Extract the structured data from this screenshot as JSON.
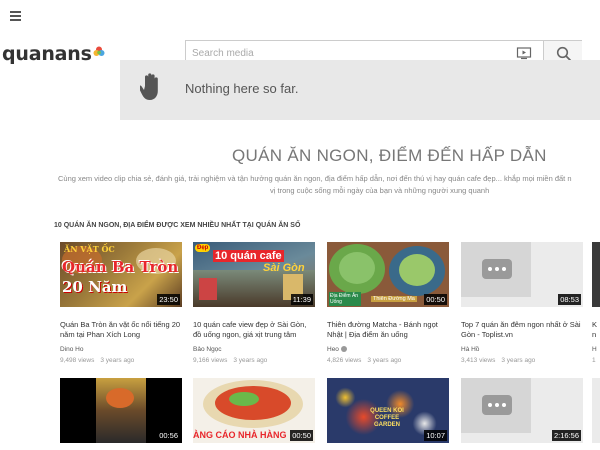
{
  "header": {
    "logo_text": "quanans",
    "search_placeholder": "Search media"
  },
  "empty_state": {
    "message": "Nothing here so far."
  },
  "hero": {
    "title": "QUÁN ĂN NGON, ĐIỂM ĐẾN HẤP DẪN",
    "subtitle_line1": "Cùng xem video clip chia sẻ, đánh giá, trải nghiệm và tận hưởng quán ăn ngon, địa điểm hấp dẫn, nơi đến thú vị hay quán cafe đẹp... khắp mọi miền đất n",
    "subtitle_line2": "vị trong cuộc sống mỗi ngày của bạn và những người xung quanh"
  },
  "section": {
    "title": "10 QUÁN ĂN NGON, ĐỊA ĐIỂM ĐƯỢC XEM NHIỀU NHẤT TẠI QUÁN ĂN SỐ"
  },
  "videos_row1": [
    {
      "title": "Quán Ba Tròn ăn vặt ốc nổi tiếng 20 năm tại Phan Xích Long",
      "channel": "Dino Ho",
      "views": "9,498 views",
      "age": "3 years ago",
      "duration": "23:50",
      "thumb_text_top": "ĂN VẶT ỐC",
      "thumb_text_main": "Quán Ba Tròn",
      "thumb_text_sub": "20 Năm"
    },
    {
      "title": "10 quán cafe view đẹp ở Sài Gòn, đồ uống ngon, giá xịt trung tâm",
      "channel": "Bảo Ngọc",
      "views": "9,166 views",
      "age": "3 years ago",
      "duration": "11:39",
      "thumb_text_main": "10 quán cafe",
      "thumb_text_sub": "Sài Gòn",
      "thumb_badge": "Đẹp"
    },
    {
      "title": "Thiên đường Matcha - Bánh ngọt Nhật | Địa điểm ăn uống",
      "channel": "Heo",
      "views": "4,826 views",
      "age": "3 years ago",
      "duration": "00:50",
      "thumb_text_left": "Địa Điểm Ăn Uống",
      "thumb_text_right": "Thiên Đường Ma"
    },
    {
      "title": "Top 7 quán ăn đêm ngon nhất ở Sài Gòn - Toplist.vn",
      "channel": "Hà Hồ",
      "views": "3,413 views",
      "age": "3 years ago",
      "duration": "08:53"
    }
  ],
  "videos_row2": [
    {
      "duration": "00:56"
    },
    {
      "duration": "00:50",
      "thumb_text": "ÀNG CÁO NHÀ HÀNG"
    },
    {
      "duration": "10:07",
      "thumb_text": "QUEEN KOI COFFEE GARDEN"
    },
    {
      "duration": "2:16:56"
    }
  ],
  "edge_column": {
    "row1_title": "K",
    "row1_title2": "n",
    "row1_channel": "H",
    "row1_views": "1"
  },
  "colors": {
    "panel_bg": "#e8e8e8",
    "text_dark": "#333333",
    "duration_bg": "#000000"
  }
}
